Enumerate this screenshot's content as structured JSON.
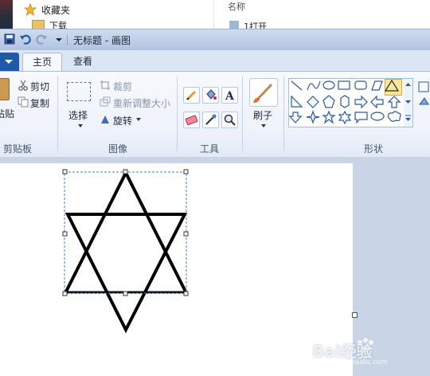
{
  "explorer": {
    "favorites_label": "收藏夹",
    "row2_label": "下载",
    "column_header": "名称",
    "doc_label": "1打开"
  },
  "window": {
    "title": "无标题 - 画图"
  },
  "tabs": [
    {
      "label": "主页",
      "active": true
    },
    {
      "label": "查看",
      "active": false
    }
  ],
  "clipboard": {
    "paste_label": "粘贴",
    "cut_label": "剪切",
    "copy_label": "复制",
    "group_label": "剪贴板"
  },
  "image": {
    "select_label": "选择",
    "crop_label": "裁剪",
    "resize_label": "重新调整大小",
    "rotate_label": "旋转",
    "group_label": "图像"
  },
  "tools": {
    "group_label": "工具",
    "brush_label": "刷子"
  },
  "shapes": {
    "group_label": "形状",
    "selected_shape": "triangle"
  },
  "watermark": {
    "main": "Bai经验",
    "sub": "jingyan.baidu.com"
  },
  "colors": {
    "ribbon_accent": "#1f5aa8",
    "selection_highlight": "#fde59a",
    "canvas": "#ffffff"
  }
}
